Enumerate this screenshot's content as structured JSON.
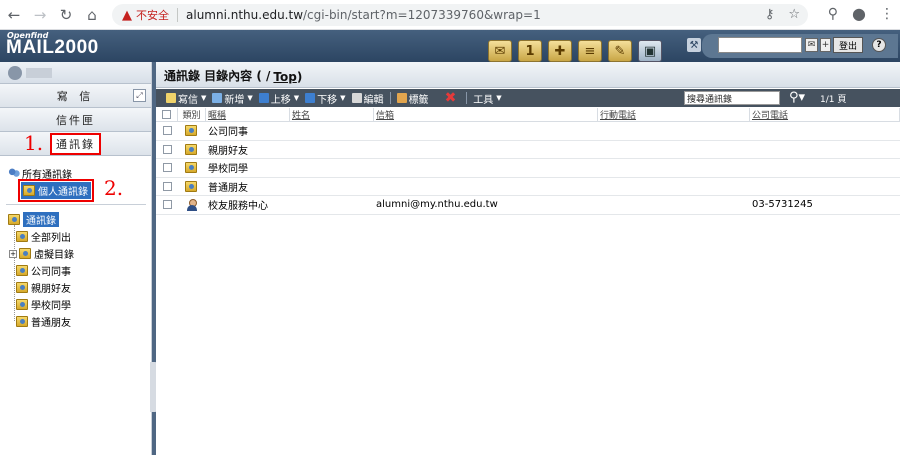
{
  "browser": {
    "insecure_label": "不安全",
    "url_host": "alumni.nthu.edu.tw",
    "url_path": "/cgi-bin/start?m=1207339760&wrap=1"
  },
  "app": {
    "logo_small": "Openfind",
    "logo": "MAIL2000",
    "logout_label": "登出",
    "help_label": "?"
  },
  "sidebar": {
    "compose_label": "寫 信",
    "inbox_label": "信件匣",
    "contacts_label": "通訊錄",
    "all_contacts": "所有通訊錄",
    "personal_contacts": "個人通訊錄",
    "book_title": "通訊錄",
    "tree": [
      "全部列出",
      "虛擬目錄",
      "公司同事",
      "親朋好友",
      "學校同學",
      "普通朋友"
    ],
    "annotation_1": "1.",
    "annotation_2": "2."
  },
  "main": {
    "title_prefix": "通訊錄 目錄內容 ( / ",
    "title_top": "Top",
    "title_suffix": " )",
    "toolbar": {
      "write": "寫信",
      "add": "新增",
      "up": "上移",
      "down": "下移",
      "edit": "編輯",
      "tag": "標籤",
      "tools": "工具",
      "search_value": "搜尋通訊錄",
      "page": "1/1 頁"
    },
    "headers": {
      "type": "類別",
      "nickname": "暱稱",
      "name": "姓名",
      "email": "信箱",
      "mobile": "行動電話",
      "company_phone": "公司電話"
    },
    "rows": [
      {
        "kind": "group",
        "nickname": "公司同事",
        "email": "",
        "company_phone": ""
      },
      {
        "kind": "group",
        "nickname": "親朋好友",
        "email": "",
        "company_phone": ""
      },
      {
        "kind": "group",
        "nickname": "學校同學",
        "email": "",
        "company_phone": ""
      },
      {
        "kind": "group",
        "nickname": "普通朋友",
        "email": "",
        "company_phone": ""
      },
      {
        "kind": "person",
        "nickname": "校友服務中心",
        "email": "alumni@my.nthu.edu.tw",
        "company_phone": "03-5731245"
      }
    ]
  },
  "colors": {
    "header_bg": "#2c4562",
    "toolbar_bg": "#46525f",
    "annotation": "#e00000",
    "selection": "#2e6fbf"
  }
}
